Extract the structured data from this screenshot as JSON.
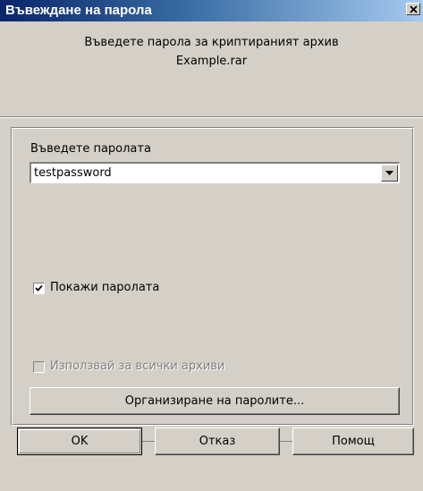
{
  "window": {
    "title": "Въвеждане на парола",
    "close_icon": "close-icon"
  },
  "prompt": {
    "line1": "Въведете парола за криптираният архив",
    "line2": "Example.rar"
  },
  "password": {
    "label": "Въведете паролата",
    "value": "testpassword",
    "dropdown_icon": "chevron-down-icon"
  },
  "options": {
    "show_password": {
      "label": "Покажи паролата",
      "checked": true,
      "enabled": true
    },
    "use_for_all": {
      "label": "Използвай за всички архиви",
      "checked": false,
      "enabled": false
    }
  },
  "buttons": {
    "manage": "Организиране на паролите...",
    "ok": "OK",
    "cancel": "Отказ",
    "help": "Помощ"
  },
  "colors": {
    "dialog_bg": "#d4d0c8",
    "titlebar_start": "#0a246a",
    "titlebar_end": "#a6caf0",
    "disabled_text": "#808080"
  }
}
